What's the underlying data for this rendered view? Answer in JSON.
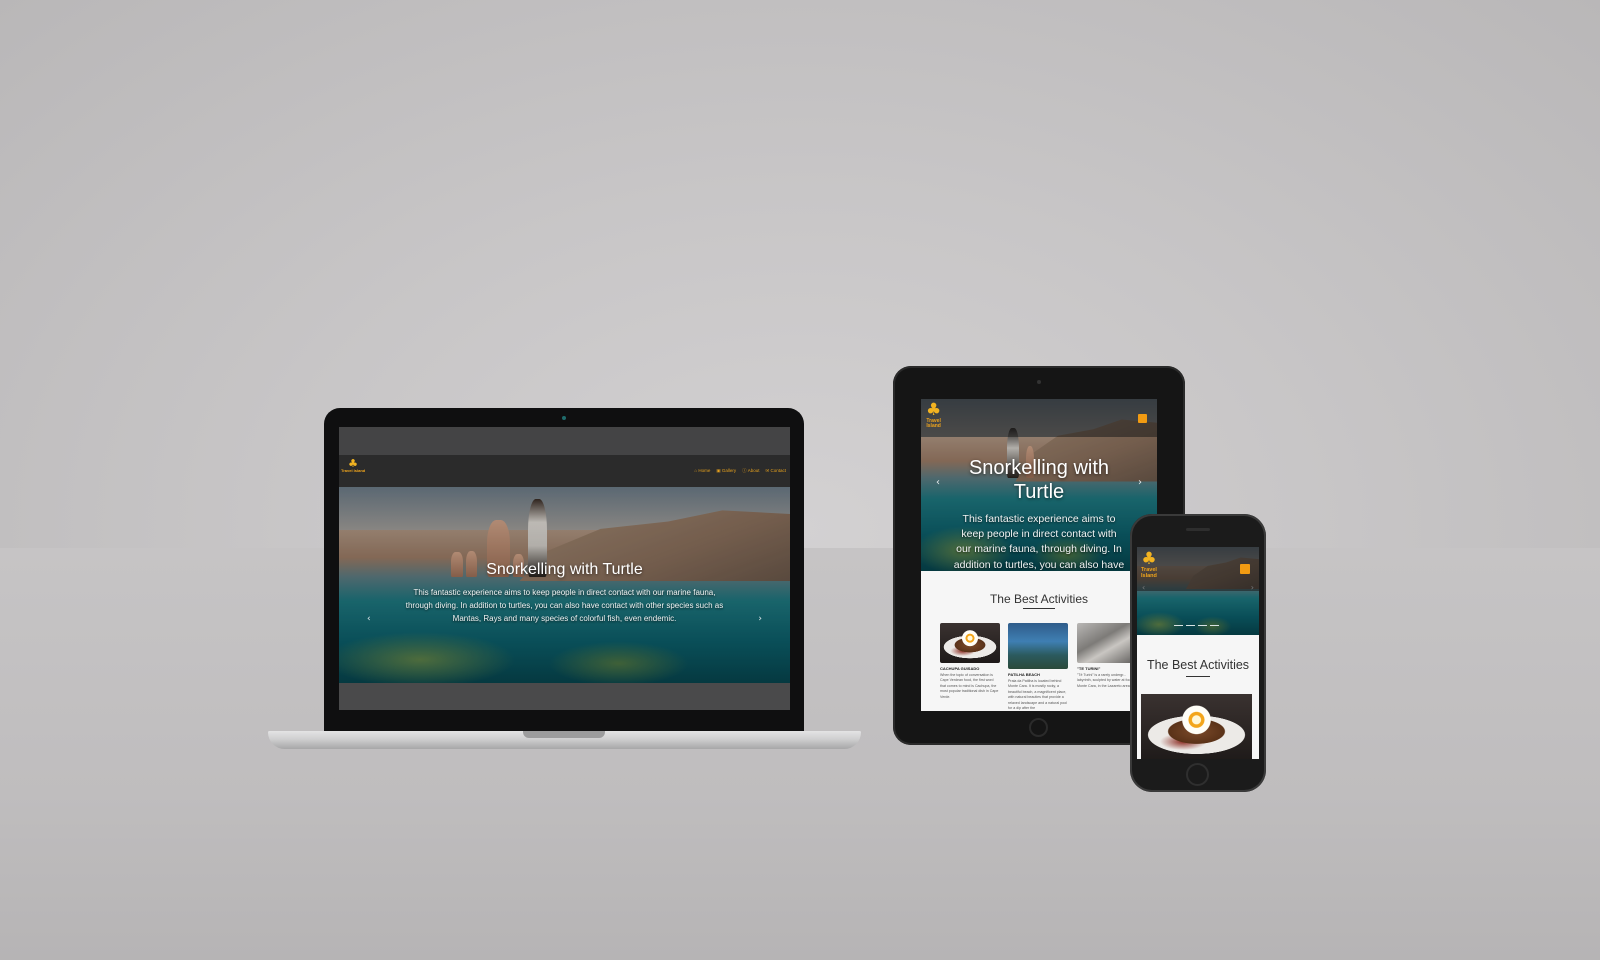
{
  "site": {
    "logo_text": "Travel Island",
    "logo_line1": "Travel",
    "logo_line2": "Island",
    "nav": [
      {
        "label": "Home",
        "icon": "home-icon"
      },
      {
        "label": "Gallery",
        "icon": "image-icon"
      },
      {
        "label": "About",
        "icon": "info-icon"
      },
      {
        "label": "Contact",
        "icon": "mail-icon"
      }
    ],
    "accent_color": "#f29b12"
  },
  "laptop": {
    "hero_title": "Snorkelling with Turtle",
    "hero_text": "This fantastic experience aims to keep people in direct contact with our marine fauna, through diving. In addition to turtles, you can also have contact with other species such as Mantas, Rays and many species of colorful fish, even endemic."
  },
  "tablet": {
    "hero_title": "Snorkelling with Turtle",
    "hero_text": "This fantastic experience aims to keep people in direct contact with our marine fauna, through diving. In addition to turtles, you can also have",
    "section_title": "The Best Activities",
    "cards": [
      {
        "title": "CACHUPA GUISADO",
        "text": "When the topic of conversation is Cape Verdean food, the first word that comes to mind is Cachupa, the most popular traditional dish in Cape Verde."
      },
      {
        "title": "PATILHA BEACH",
        "text": "Praia da Patilha is located behind Monte Cara. It is mostly rocky, a beautiful beach, a magnificent place, with natural beauties that provide a relaxed landscape and a natural pool for a dip after the"
      },
      {
        "title": "\"TE TURINI\"",
        "text": "\"Tê Turini\" is a rarely undergr... labyrinth, sculpted by water at foot of Monte Cara, in the Lazareto area."
      }
    ]
  },
  "phone": {
    "section_title": "The Best Activities"
  }
}
